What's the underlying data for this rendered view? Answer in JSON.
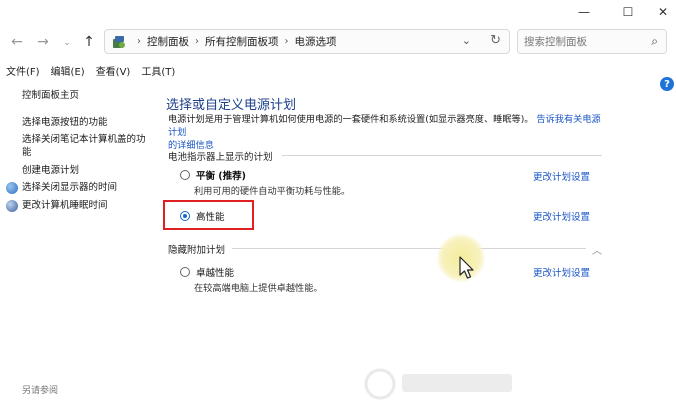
{
  "address": {
    "crumbs": [
      "控制面板",
      "所有控制面板项",
      "电源选项"
    ],
    "search_placeholder": "搜索控制面板"
  },
  "menu": [
    "文件(F)",
    "编辑(E)",
    "查看(V)",
    "工具(T)"
  ],
  "sidebar": {
    "home": "控制面板主页",
    "links": [
      "选择电源按钮的功能",
      "选择关闭笔记本计算机盖的功",
      "能",
      "创建电源计划",
      "选择关闭显示器的时间",
      "更改计算机睡眠时间"
    ],
    "see_also": "另请参阅"
  },
  "main": {
    "title": "选择或自定义电源计划",
    "description": "电源计划是用于管理计算机如何使用电源的一套硬件和系统设置(如显示器亮度、睡眠等)。",
    "description_link_1": "告诉我有关电源计划",
    "description_link_2": "的详细信息",
    "battery_section": "电池指示器上显示的计划",
    "hidden_section": "隐藏附加计划",
    "change_label": "更改计划设置",
    "plans": [
      {
        "name": "平衡 (推荐)",
        "desc": "利用可用的硬件自动平衡功耗与性能。",
        "selected": false
      },
      {
        "name": "高性能",
        "desc": "",
        "selected": true
      },
      {
        "name": "卓越性能",
        "desc": "在较高端电脑上提供卓越性能。",
        "selected": false
      }
    ]
  },
  "colors": {
    "link": "#1a56c4",
    "title": "#1d3f8a",
    "highlight": "#e02020",
    "radio": "#1769d4"
  }
}
